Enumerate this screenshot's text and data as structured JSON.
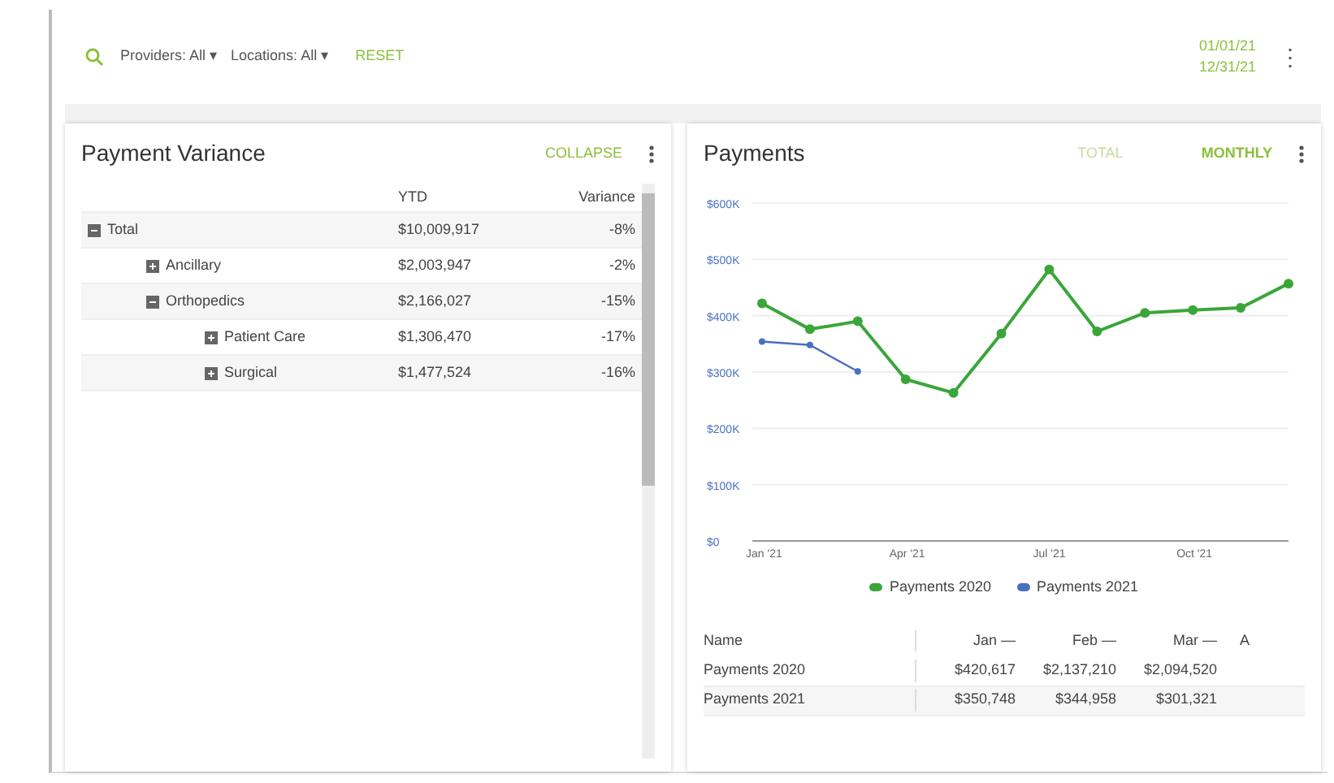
{
  "filters": [
    {
      "label": "Providers: All",
      "kind": "dropdown",
      "caret": "▾"
    },
    {
      "label": "Locations: All",
      "kind": "dropdown",
      "caret": "▾"
    },
    {
      "label": "RESET",
      "kind": "link"
    }
  ],
  "dates": [
    "01/01/21",
    "12/31/21"
  ],
  "menu_glyph": "⋮",
  "variance": {
    "title": "Payment Variance",
    "action": "COLLAPSE",
    "columns": [
      "YTD",
      "Variance"
    ],
    "rows": [
      {
        "name": "Total",
        "expanded": true,
        "ytd": "$10,009,917",
        "variance": "-8%",
        "children": [
          {
            "name": "Ancillary",
            "expanded": false,
            "ytd": "$2,003,947",
            "variance": "-2%"
          },
          {
            "name": "Orthopedics",
            "expanded": true,
            "ytd": "$2,166,027",
            "variance": "-15%",
            "children": [
              {
                "name": "Patient Care",
                "expanded": false,
                "ytd": "$1,306,470",
                "variance": "-17%"
              },
              {
                "name": "Surgical",
                "expanded": false,
                "ytd": "$1,477,524",
                "variance": "-16%"
              }
            ]
          }
        ]
      }
    ]
  },
  "payments": {
    "title": "Payments",
    "toggles": [
      {
        "label": "TOTAL",
        "selected": false
      },
      {
        "label": "MONTHLY",
        "selected": true
      }
    ],
    "chart_data": {
      "type": "line",
      "grid": true,
      "categories": [
        "Jan '21",
        null,
        null,
        "Apr '21",
        null,
        null,
        "Jul '21",
        null,
        null,
        "Oct '21",
        null,
        null
      ],
      "yticks": [
        {
          "value": 0,
          "label": "$0"
        },
        {
          "value": 100000,
          "label": "$100K"
        },
        {
          "value": 200000,
          "label": "$200K"
        },
        {
          "value": 300000,
          "label": "$300K"
        },
        {
          "value": 400000,
          "label": "$400K"
        },
        {
          "value": 500000,
          "label": "$500K"
        },
        {
          "value": 600000,
          "label": "$600K"
        }
      ],
      "ylim": [
        0,
        600000
      ],
      "series": [
        {
          "name": "Payments 2020",
          "color": "#3aa63a",
          "marker": "circle",
          "values": [
            422000,
            376000,
            390000,
            287000,
            263000,
            368000,
            482000,
            372000,
            405000,
            410000,
            414000,
            457000
          ]
        },
        {
          "name": "Payments 2021",
          "color": "#4a6fc0",
          "marker": "circle",
          "values": [
            354000,
            348000,
            301000,
            null,
            null,
            null,
            null,
            null,
            null,
            null,
            null,
            null
          ]
        }
      ]
    },
    "table": {
      "columns": [
        "Name",
        "Jan —",
        "Feb —",
        "Mar —",
        "A"
      ],
      "rows": [
        {
          "cells": [
            "Payments 2020",
            "$420,617",
            "$2,137,210",
            "$2,094,520"
          ]
        },
        {
          "cells": [
            "Payments 2021",
            "$350,748",
            "$344,958",
            "$301,321"
          ]
        }
      ]
    }
  }
}
